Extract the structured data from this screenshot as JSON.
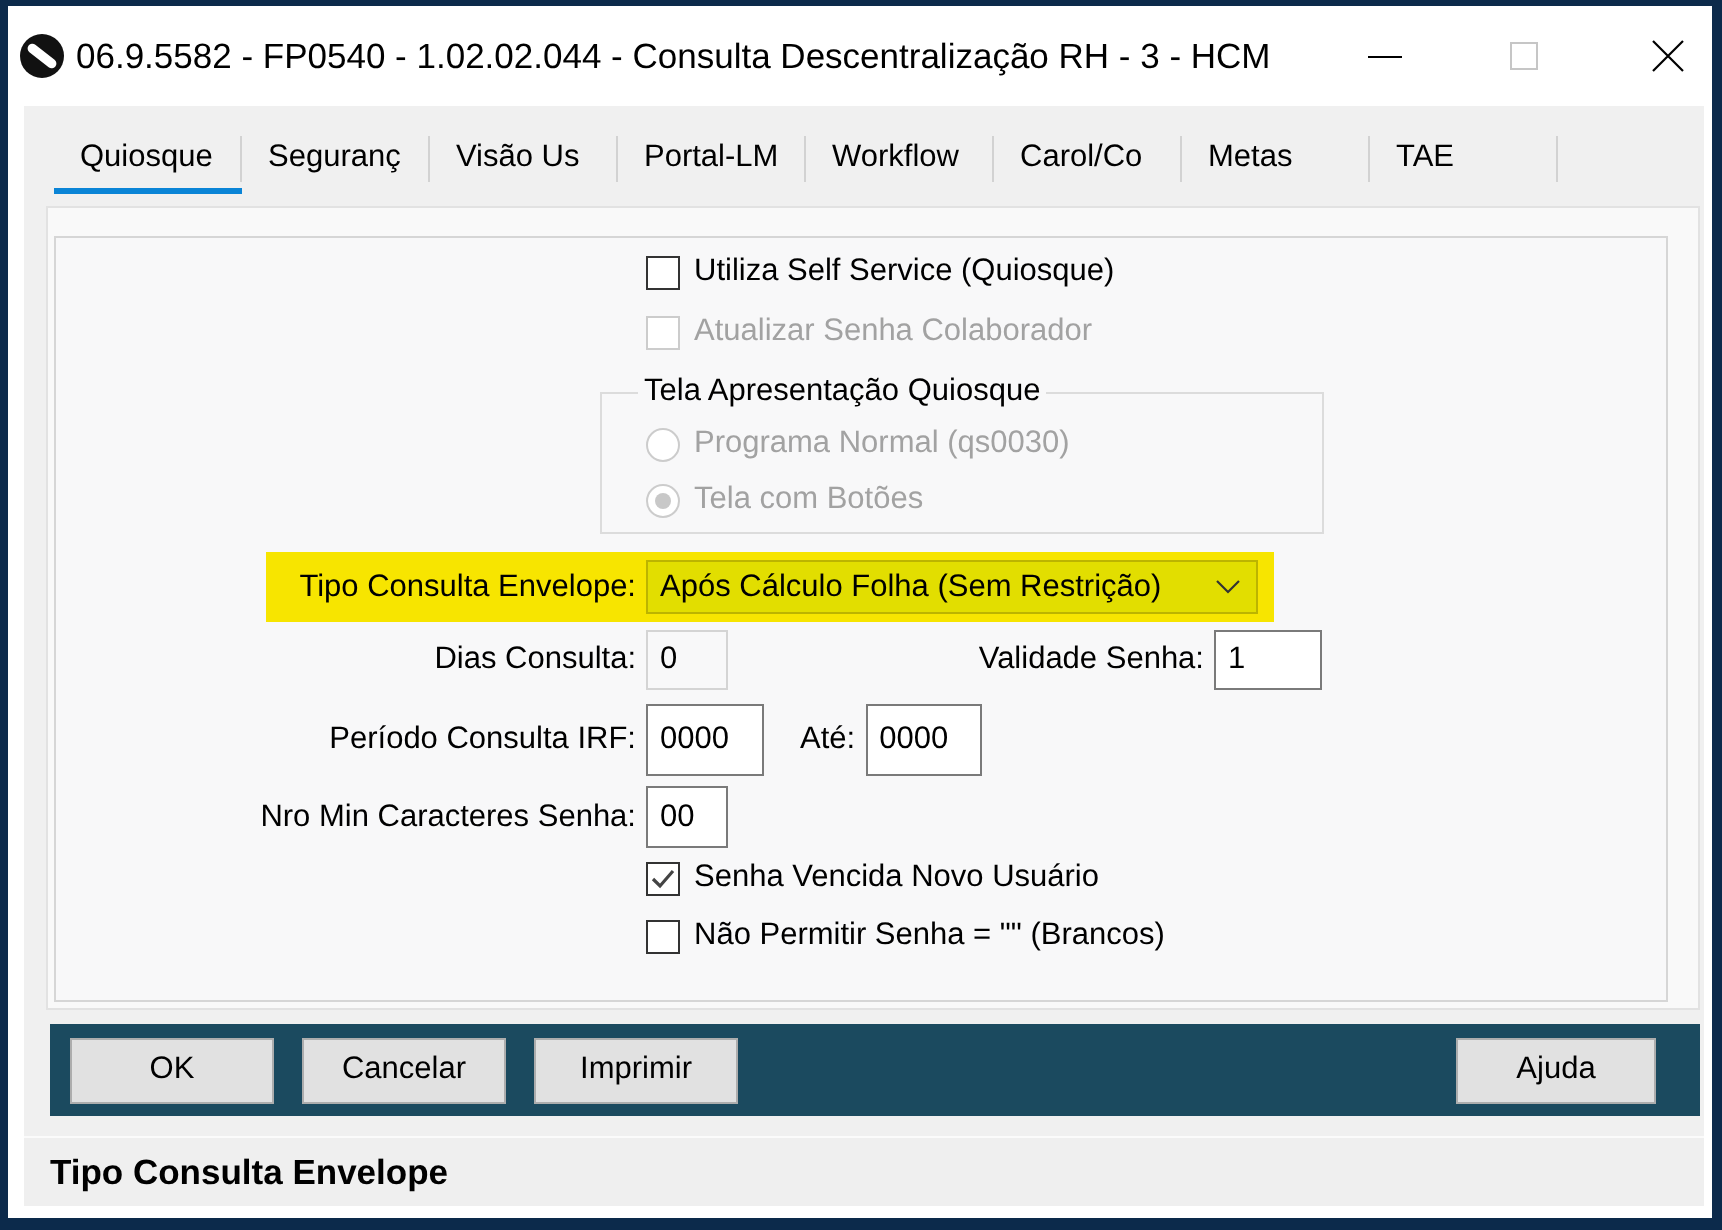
{
  "window": {
    "title": "06.9.5582 - FP0540 - 1.02.02.044 - Consulta Descentralização RH - 3 - HCM",
    "maximize_disabled": true
  },
  "tabs": [
    {
      "label": "Quiosque",
      "selected": true
    },
    {
      "label": "Seguranç",
      "selected": false
    },
    {
      "label": "Visão Us",
      "selected": false
    },
    {
      "label": "Portal-LM",
      "selected": false
    },
    {
      "label": "Workflow",
      "selected": false
    },
    {
      "label": "Carol/Co",
      "selected": false
    },
    {
      "label": "Metas",
      "selected": false
    },
    {
      "label": "TAE",
      "selected": false
    }
  ],
  "options_top": [
    {
      "label": "Utiliza Self Service (Quiosque)",
      "checked": false,
      "disabled": false
    },
    {
      "label": "Atualizar Senha Colaborador",
      "checked": false,
      "disabled": true
    }
  ],
  "presentation_group": {
    "title": "Tela Apresentação Quiosque",
    "options": [
      {
        "label": "Programa Normal (qs0030)",
        "selected": false,
        "disabled": true
      },
      {
        "label": "Tela com Botões",
        "selected": true,
        "disabled": true
      }
    ]
  },
  "envelope": {
    "label": "Tipo Consulta Envelope:",
    "value": "Após Cálculo Folha (Sem Restrição)",
    "highlighted": true
  },
  "dias_consulta": {
    "label": "Dias Consulta:",
    "value": "0",
    "disabled": true
  },
  "validade_senha": {
    "label": "Validade Senha:",
    "value": "1",
    "disabled": false
  },
  "periodo_irf": {
    "label": "Período Consulta IRF:",
    "value": "0000",
    "disabled": false
  },
  "periodo_ate": {
    "label": "Até:",
    "value": "0000",
    "disabled": false
  },
  "nro_min_caracteres": {
    "label": "Nro Min Caracteres Senha:",
    "value": "00",
    "disabled": false
  },
  "options_bottom": [
    {
      "label": "Senha Vencida Novo Usuário",
      "checked": true,
      "disabled": false
    },
    {
      "label": "Não Permitir Senha = \"\" (Brancos)",
      "checked": false,
      "disabled": false
    }
  ],
  "buttons": [
    {
      "label": "OK"
    },
    {
      "label": "Cancelar"
    },
    {
      "label": "Imprimir"
    }
  ],
  "help_button": {
    "label": "Ajuda"
  },
  "status_bar": {
    "text": "Tipo Consulta Envelope"
  }
}
